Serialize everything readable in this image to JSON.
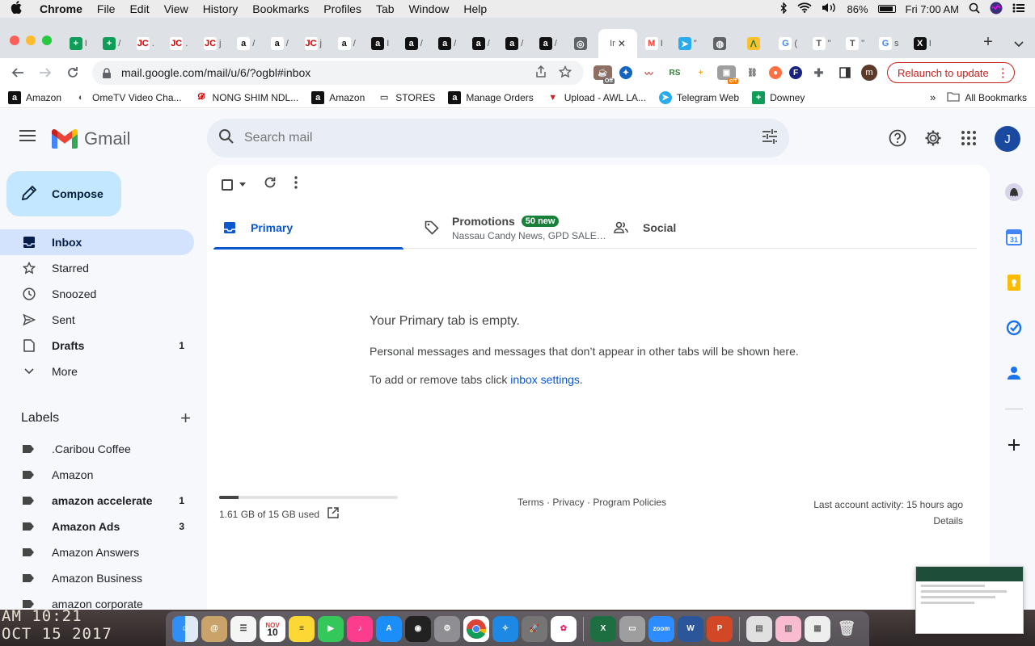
{
  "menubar": {
    "app": "Chrome",
    "items": [
      "File",
      "Edit",
      "View",
      "History",
      "Bookmarks",
      "Profiles",
      "Tab",
      "Window",
      "Help"
    ],
    "battery": "86%",
    "clock": "Fri 7:00 AM"
  },
  "browser": {
    "url": "mail.google.com/mail/u/6/?ogbl#inbox",
    "relaunch_label": "Relaunch to update",
    "profile_initial": "m",
    "ext_badge_off_1": "Off",
    "ext_badge_off_2": "off",
    "tabs": [
      {
        "icon": "sheets-icon",
        "label": "I"
      },
      {
        "icon": "sheets-icon",
        "label": "/"
      },
      {
        "icon": "jc-icon",
        "label": "."
      },
      {
        "icon": "jc-icon",
        "label": "."
      },
      {
        "icon": "jc-icon",
        "label": "j"
      },
      {
        "icon": "amazon-icon",
        "label": "/"
      },
      {
        "icon": "amazon-icon",
        "label": "/"
      },
      {
        "icon": "jc-icon",
        "label": "j"
      },
      {
        "icon": "amazon-icon",
        "label": "/"
      },
      {
        "icon": "amazon-dark-icon",
        "label": "I"
      },
      {
        "icon": "amazon-dark-icon",
        "label": "/"
      },
      {
        "icon": "amazon-dark-icon",
        "label": "/"
      },
      {
        "icon": "amazon-dark-icon",
        "label": "/"
      },
      {
        "icon": "amazon-dark-icon",
        "label": "/"
      },
      {
        "icon": "amazon-dark-icon",
        "label": "/"
      },
      {
        "icon": "chrome-icon",
        "label": ""
      },
      {
        "icon": "active",
        "label": "Ir"
      },
      {
        "icon": "gmail-icon",
        "label": "I"
      },
      {
        "icon": "telegram-icon",
        "label": "\""
      },
      {
        "icon": "globe-icon",
        "label": ""
      },
      {
        "icon": "app-icon",
        "label": ""
      },
      {
        "icon": "google-icon",
        "label": "("
      },
      {
        "icon": "t-icon",
        "label": "\""
      },
      {
        "icon": "t-icon",
        "label": "\""
      },
      {
        "icon": "google-icon",
        "label": "s"
      },
      {
        "icon": "x-icon",
        "label": "I"
      }
    ]
  },
  "bookmarks": [
    {
      "icon": "amazon-icon",
      "label": "Amazon"
    },
    {
      "icon": "ometv-icon",
      "label": "OmeTV Video Cha..."
    },
    {
      "icon": "nongshim-icon",
      "label": "NONG SHIM NDL..."
    },
    {
      "icon": "amazon-icon",
      "label": "Amazon"
    },
    {
      "icon": "folder-icon",
      "label": "STORES"
    },
    {
      "icon": "amazon-icon",
      "label": "Manage Orders"
    },
    {
      "icon": "awl-icon",
      "label": "Upload - AWL LA..."
    },
    {
      "icon": "telegram-icon",
      "label": "Telegram Web"
    },
    {
      "icon": "sheets-icon",
      "label": "Downey"
    }
  ],
  "bookmarks_more": "»",
  "bookmarks_all": "All Bookmarks",
  "gmail": {
    "logo_text": "Gmail",
    "search_placeholder": "Search mail",
    "user_initial": "J",
    "compose_label": "Compose",
    "nav": [
      {
        "label": "Inbox",
        "count": "",
        "icon": "inbox-icon",
        "active": true,
        "bold": true
      },
      {
        "label": "Starred",
        "count": "",
        "icon": "star-icon",
        "active": false,
        "bold": false
      },
      {
        "label": "Snoozed",
        "count": "",
        "icon": "clock-icon",
        "active": false,
        "bold": false
      },
      {
        "label": "Sent",
        "count": "",
        "icon": "send-icon",
        "active": false,
        "bold": false
      },
      {
        "label": "Drafts",
        "count": "1",
        "icon": "draft-icon",
        "active": false,
        "bold": true
      },
      {
        "label": "More",
        "count": "",
        "icon": "chevron-down-icon",
        "active": false,
        "bold": false
      }
    ],
    "labels_title": "Labels",
    "labels": [
      {
        "label": ".Caribou Coffee",
        "count": "",
        "bold": false
      },
      {
        "label": "Amazon",
        "count": "",
        "bold": false
      },
      {
        "label": "amazon accelerate",
        "count": "1",
        "bold": true
      },
      {
        "label": "Amazon Ads",
        "count": "3",
        "bold": true
      },
      {
        "label": "Amazon Answers",
        "count": "",
        "bold": false
      },
      {
        "label": "Amazon Business",
        "count": "",
        "bold": false
      },
      {
        "label": "amazon corporate",
        "count": "",
        "bold": false
      }
    ],
    "tabs": {
      "primary": "Primary",
      "promotions": "Promotions",
      "promotions_badge": "50 new",
      "promotions_sub": "Nassau Candy News, GPD SALE…",
      "social": "Social"
    },
    "empty": {
      "title": "Your Primary tab is empty.",
      "body": "Personal messages and messages that don’t appear in other tabs will be shown here.",
      "settings_prefix": "To add or remove tabs click",
      "settings_link": "inbox settings",
      "settings_suffix": "."
    },
    "footer": {
      "storage": "1.61 GB of 15 GB used",
      "storage_fraction": 0.107,
      "links": "Terms · Privacy · Program Policies",
      "activity": "Last account activity: 15 hours ago",
      "details": "Details"
    }
  },
  "desktop": {
    "stamp_line1": "AM 10:21",
    "stamp_line2": "OCT 15 2017",
    "calendar_month": "NOV",
    "calendar_day": "10",
    "zoom_label": "zoom"
  }
}
